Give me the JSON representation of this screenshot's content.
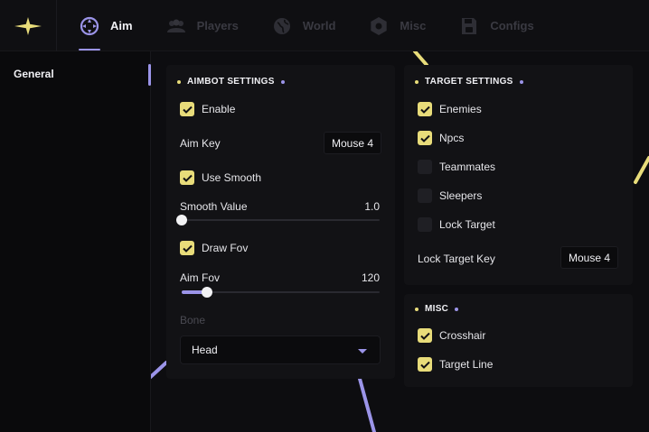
{
  "colors": {
    "accent_yellow": "#e8dc7a",
    "accent_purple": "#9b94e8",
    "background": "#0d0d10",
    "panel": "#121215"
  },
  "logo": {
    "icon": "sparkle-icon"
  },
  "tabs": [
    {
      "label": "Aim",
      "icon": "crosshair-icon",
      "active": true
    },
    {
      "label": "Players",
      "icon": "users-icon",
      "active": false
    },
    {
      "label": "World",
      "icon": "globe-icon",
      "active": false
    },
    {
      "label": "Misc",
      "icon": "gear-icon",
      "active": false
    },
    {
      "label": "Configs",
      "icon": "save-icon",
      "active": false
    }
  ],
  "sidebar": {
    "items": [
      {
        "label": "General",
        "active": true
      }
    ]
  },
  "aimbot": {
    "title": "AIMBOT SETTINGS",
    "enable": {
      "label": "Enable",
      "checked": true
    },
    "aim_key": {
      "label": "Aim Key",
      "value": "Mouse 4"
    },
    "use_smooth": {
      "label": "Use Smooth",
      "checked": true
    },
    "smooth_value": {
      "label": "Smooth Value",
      "value": "1.0",
      "fraction": 0.0
    },
    "draw_fov": {
      "label": "Draw Fov",
      "checked": true
    },
    "aim_fov": {
      "label": "Aim Fov",
      "value": "120",
      "fraction": 0.13
    },
    "bone": {
      "label": "Bone",
      "selected": "Head"
    }
  },
  "target": {
    "title": "TARGET SETTINGS",
    "enemies": {
      "label": "Enemies",
      "checked": true
    },
    "npcs": {
      "label": "Npcs",
      "checked": true
    },
    "teammates": {
      "label": "Teammates",
      "checked": false
    },
    "sleepers": {
      "label": "Sleepers",
      "checked": false
    },
    "lock_target": {
      "label": "Lock Target",
      "checked": false
    },
    "lock_target_key": {
      "label": "Lock Target Key",
      "value": "Mouse 4"
    }
  },
  "misc": {
    "title": "MISC",
    "crosshair": {
      "label": "Crosshair",
      "checked": true
    },
    "target_line": {
      "label": "Target Line",
      "checked": true
    }
  }
}
